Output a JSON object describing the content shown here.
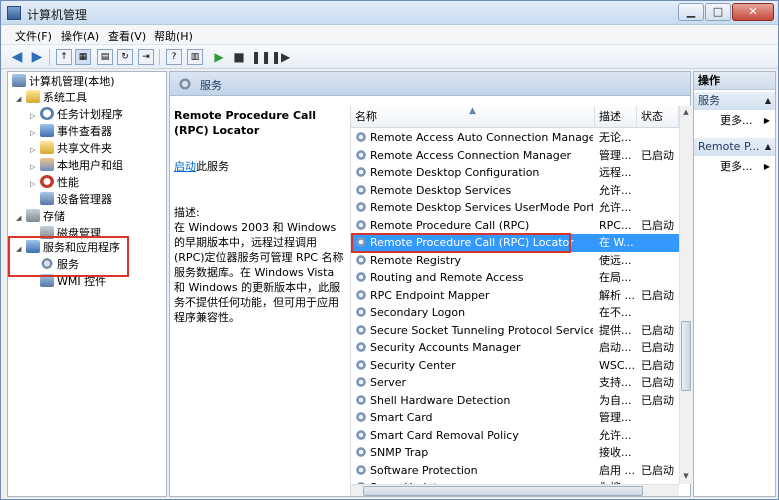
{
  "window": {
    "title": "计算机管理"
  },
  "menu": [
    {
      "label": "文件(F)"
    },
    {
      "label": "操作(A)"
    },
    {
      "label": "查看(V)"
    },
    {
      "label": "帮助(H)"
    }
  ],
  "tree": [
    {
      "label": "计算机管理(本地)",
      "icon": "computer-icon"
    },
    {
      "label": "系统工具",
      "icon": "tools-icon"
    },
    {
      "label": "任务计划程序",
      "icon": "clock-icon"
    },
    {
      "label": "事件查看器",
      "icon": "event-icon"
    },
    {
      "label": "共享文件夹",
      "icon": "folder-icon"
    },
    {
      "label": "本地用户和组",
      "icon": "users-icon"
    },
    {
      "label": "性能",
      "icon": "performance-icon"
    },
    {
      "label": "设备管理器",
      "icon": "device-icon"
    },
    {
      "label": "存储",
      "icon": "storage-icon"
    },
    {
      "label": "磁盘管理",
      "icon": "disk-icon"
    },
    {
      "label": "服务和应用程序",
      "icon": "apps-icon"
    },
    {
      "label": "服务",
      "icon": "gear-icon"
    },
    {
      "label": "WMI 控件",
      "icon": "wmi-icon"
    }
  ],
  "middle": {
    "header": "服务",
    "detail_title": "Remote Procedure Call (RPC) Locator",
    "start_link": "启动",
    "start_suffix": "此服务",
    "desc_label": "描述:",
    "desc_text": "在 Windows 2003 和 Windows 的早期版本中，远程过程调用(RPC)定位器服务可管理 RPC 名称服务数据库。在 Windows Vista 和 Windows 的更新版本中，此服务不提供任何功能，但可用于应用程序兼容性。"
  },
  "columns": {
    "name": "名称",
    "desc": "描述",
    "status": "状态"
  },
  "services": [
    {
      "name": "Remote Access Auto Connection Manager",
      "desc": "无论...",
      "status": ""
    },
    {
      "name": "Remote Access Connection Manager",
      "desc": "管理...",
      "status": "已启动"
    },
    {
      "name": "Remote Desktop Configuration",
      "desc": "远程...",
      "status": ""
    },
    {
      "name": "Remote Desktop Services",
      "desc": "允许...",
      "status": ""
    },
    {
      "name": "Remote Desktop Services UserMode Port R...",
      "desc": "允许...",
      "status": ""
    },
    {
      "name": "Remote Procedure Call (RPC)",
      "desc": "RPC...",
      "status": "已启动"
    },
    {
      "name": "Remote Procedure Call (RPC) Locator",
      "desc": "在 W...",
      "status": ""
    },
    {
      "name": "Remote Registry",
      "desc": "使远...",
      "status": ""
    },
    {
      "name": "Routing and Remote Access",
      "desc": "在局...",
      "status": ""
    },
    {
      "name": "RPC Endpoint Mapper",
      "desc": "解析 ...",
      "status": "已启动"
    },
    {
      "name": "Secondary Logon",
      "desc": "在不...",
      "status": ""
    },
    {
      "name": "Secure Socket Tunneling Protocol Service",
      "desc": "提供...",
      "status": "已启动"
    },
    {
      "name": "Security Accounts Manager",
      "desc": "启动...",
      "status": "已启动"
    },
    {
      "name": "Security Center",
      "desc": "WSC...",
      "status": "已启动"
    },
    {
      "name": "Server",
      "desc": "支持...",
      "status": "已启动"
    },
    {
      "name": "Shell Hardware Detection",
      "desc": "为自...",
      "status": "已启动"
    },
    {
      "name": "Smart Card",
      "desc": "管理...",
      "status": ""
    },
    {
      "name": "Smart Card Removal Policy",
      "desc": "允许...",
      "status": ""
    },
    {
      "name": "SNMP Trap",
      "desc": "接收...",
      "status": ""
    },
    {
      "name": "Software Protection",
      "desc": "启用 ...",
      "status": "已启动"
    },
    {
      "name": "SogouUpdate",
      "desc": "为搜...",
      "status": ""
    }
  ],
  "actions": {
    "title": "操作",
    "section1": "服务",
    "more1": "更多...",
    "section2": "Remote P...",
    "more2": "更多..."
  },
  "colors": {
    "selection": "#3399ff",
    "highlight_box": "#d9342b"
  }
}
